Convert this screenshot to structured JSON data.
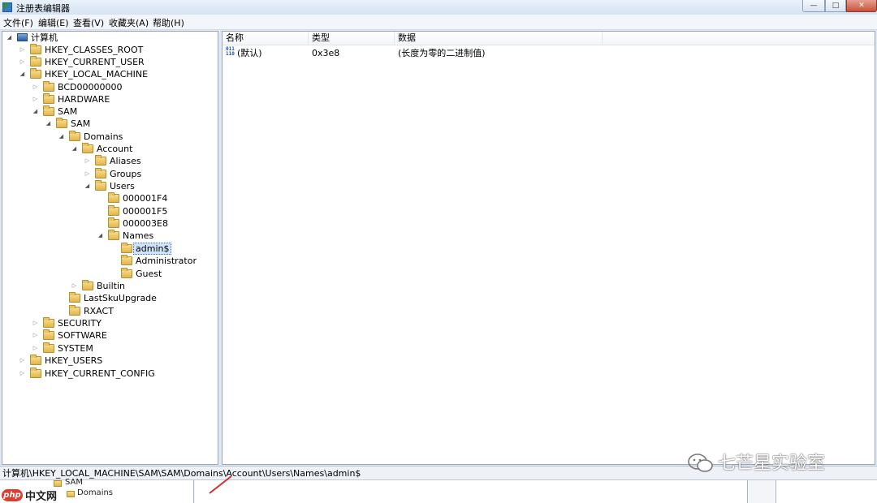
{
  "window": {
    "title": "注册表编辑器",
    "minimize_glyph": "—",
    "maximize_glyph": "□",
    "close_glyph": "✕"
  },
  "menu": [
    "文件(F)",
    "编辑(E)",
    "查看(V)",
    "收藏夹(A)",
    "帮助(H)"
  ],
  "tree": {
    "root": "计算机",
    "nodes": [
      "HKEY_CLASSES_ROOT",
      "HKEY_CURRENT_USER",
      "HKEY_LOCAL_MACHINE",
      "BCD00000000",
      "HARDWARE",
      "SAM",
      "SAM",
      "Domains",
      "Account",
      "Aliases",
      "Groups",
      "Users",
      "000001F4",
      "000001F5",
      "000003E8",
      "Names",
      "admin$",
      "Administrator",
      "Guest",
      "Builtin",
      "LastSkuUpgrade",
      "RXACT",
      "SECURITY",
      "SOFTWARE",
      "SYSTEM",
      "HKEY_USERS",
      "HKEY_CURRENT_CONFIG"
    ],
    "selected": "admin$"
  },
  "list": {
    "columns": [
      "名称",
      "类型",
      "数据"
    ],
    "rows": [
      {
        "name": "(默认)",
        "type": "0x3e8",
        "data": "(长度为零的二进制值)"
      }
    ]
  },
  "status": {
    "path": "计算机\\HKEY_LOCAL_MACHINE\\SAM\\SAM\\Domains\\Account\\Users\\Names\\admin$"
  },
  "watermark": "七芒星实验室",
  "background": {
    "sam": "SAM",
    "domains": "Domains",
    "php_badge": "php",
    "php_site": "中文网"
  },
  "colors": {
    "selection": "#cfe3fb",
    "folder": "#e2b54b",
    "close_button": "#c7503a"
  }
}
